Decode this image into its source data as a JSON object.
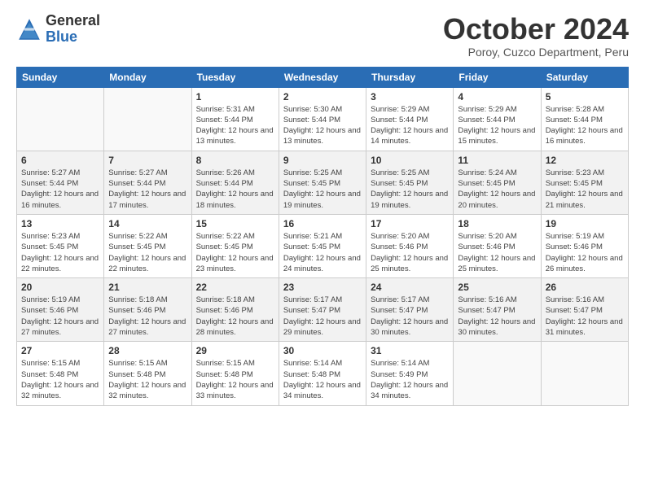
{
  "logo": {
    "general": "General",
    "blue": "Blue"
  },
  "title": "October 2024",
  "subtitle": "Poroy, Cuzco Department, Peru",
  "days_of_week": [
    "Sunday",
    "Monday",
    "Tuesday",
    "Wednesday",
    "Thursday",
    "Friday",
    "Saturday"
  ],
  "weeks": [
    [
      {
        "day": "",
        "sunrise": "",
        "sunset": "",
        "daylight": ""
      },
      {
        "day": "",
        "sunrise": "",
        "sunset": "",
        "daylight": ""
      },
      {
        "day": "1",
        "sunrise": "Sunrise: 5:31 AM",
        "sunset": "Sunset: 5:44 PM",
        "daylight": "Daylight: 12 hours and 13 minutes."
      },
      {
        "day": "2",
        "sunrise": "Sunrise: 5:30 AM",
        "sunset": "Sunset: 5:44 PM",
        "daylight": "Daylight: 12 hours and 13 minutes."
      },
      {
        "day": "3",
        "sunrise": "Sunrise: 5:29 AM",
        "sunset": "Sunset: 5:44 PM",
        "daylight": "Daylight: 12 hours and 14 minutes."
      },
      {
        "day": "4",
        "sunrise": "Sunrise: 5:29 AM",
        "sunset": "Sunset: 5:44 PM",
        "daylight": "Daylight: 12 hours and 15 minutes."
      },
      {
        "day": "5",
        "sunrise": "Sunrise: 5:28 AM",
        "sunset": "Sunset: 5:44 PM",
        "daylight": "Daylight: 12 hours and 16 minutes."
      }
    ],
    [
      {
        "day": "6",
        "sunrise": "Sunrise: 5:27 AM",
        "sunset": "Sunset: 5:44 PM",
        "daylight": "Daylight: 12 hours and 16 minutes."
      },
      {
        "day": "7",
        "sunrise": "Sunrise: 5:27 AM",
        "sunset": "Sunset: 5:44 PM",
        "daylight": "Daylight: 12 hours and 17 minutes."
      },
      {
        "day": "8",
        "sunrise": "Sunrise: 5:26 AM",
        "sunset": "Sunset: 5:44 PM",
        "daylight": "Daylight: 12 hours and 18 minutes."
      },
      {
        "day": "9",
        "sunrise": "Sunrise: 5:25 AM",
        "sunset": "Sunset: 5:45 PM",
        "daylight": "Daylight: 12 hours and 19 minutes."
      },
      {
        "day": "10",
        "sunrise": "Sunrise: 5:25 AM",
        "sunset": "Sunset: 5:45 PM",
        "daylight": "Daylight: 12 hours and 19 minutes."
      },
      {
        "day": "11",
        "sunrise": "Sunrise: 5:24 AM",
        "sunset": "Sunset: 5:45 PM",
        "daylight": "Daylight: 12 hours and 20 minutes."
      },
      {
        "day": "12",
        "sunrise": "Sunrise: 5:23 AM",
        "sunset": "Sunset: 5:45 PM",
        "daylight": "Daylight: 12 hours and 21 minutes."
      }
    ],
    [
      {
        "day": "13",
        "sunrise": "Sunrise: 5:23 AM",
        "sunset": "Sunset: 5:45 PM",
        "daylight": "Daylight: 12 hours and 22 minutes."
      },
      {
        "day": "14",
        "sunrise": "Sunrise: 5:22 AM",
        "sunset": "Sunset: 5:45 PM",
        "daylight": "Daylight: 12 hours and 22 minutes."
      },
      {
        "day": "15",
        "sunrise": "Sunrise: 5:22 AM",
        "sunset": "Sunset: 5:45 PM",
        "daylight": "Daylight: 12 hours and 23 minutes."
      },
      {
        "day": "16",
        "sunrise": "Sunrise: 5:21 AM",
        "sunset": "Sunset: 5:45 PM",
        "daylight": "Daylight: 12 hours and 24 minutes."
      },
      {
        "day": "17",
        "sunrise": "Sunrise: 5:20 AM",
        "sunset": "Sunset: 5:46 PM",
        "daylight": "Daylight: 12 hours and 25 minutes."
      },
      {
        "day": "18",
        "sunrise": "Sunrise: 5:20 AM",
        "sunset": "Sunset: 5:46 PM",
        "daylight": "Daylight: 12 hours and 25 minutes."
      },
      {
        "day": "19",
        "sunrise": "Sunrise: 5:19 AM",
        "sunset": "Sunset: 5:46 PM",
        "daylight": "Daylight: 12 hours and 26 minutes."
      }
    ],
    [
      {
        "day": "20",
        "sunrise": "Sunrise: 5:19 AM",
        "sunset": "Sunset: 5:46 PM",
        "daylight": "Daylight: 12 hours and 27 minutes."
      },
      {
        "day": "21",
        "sunrise": "Sunrise: 5:18 AM",
        "sunset": "Sunset: 5:46 PM",
        "daylight": "Daylight: 12 hours and 27 minutes."
      },
      {
        "day": "22",
        "sunrise": "Sunrise: 5:18 AM",
        "sunset": "Sunset: 5:46 PM",
        "daylight": "Daylight: 12 hours and 28 minutes."
      },
      {
        "day": "23",
        "sunrise": "Sunrise: 5:17 AM",
        "sunset": "Sunset: 5:47 PM",
        "daylight": "Daylight: 12 hours and 29 minutes."
      },
      {
        "day": "24",
        "sunrise": "Sunrise: 5:17 AM",
        "sunset": "Sunset: 5:47 PM",
        "daylight": "Daylight: 12 hours and 30 minutes."
      },
      {
        "day": "25",
        "sunrise": "Sunrise: 5:16 AM",
        "sunset": "Sunset: 5:47 PM",
        "daylight": "Daylight: 12 hours and 30 minutes."
      },
      {
        "day": "26",
        "sunrise": "Sunrise: 5:16 AM",
        "sunset": "Sunset: 5:47 PM",
        "daylight": "Daylight: 12 hours and 31 minutes."
      }
    ],
    [
      {
        "day": "27",
        "sunrise": "Sunrise: 5:15 AM",
        "sunset": "Sunset: 5:48 PM",
        "daylight": "Daylight: 12 hours and 32 minutes."
      },
      {
        "day": "28",
        "sunrise": "Sunrise: 5:15 AM",
        "sunset": "Sunset: 5:48 PM",
        "daylight": "Daylight: 12 hours and 32 minutes."
      },
      {
        "day": "29",
        "sunrise": "Sunrise: 5:15 AM",
        "sunset": "Sunset: 5:48 PM",
        "daylight": "Daylight: 12 hours and 33 minutes."
      },
      {
        "day": "30",
        "sunrise": "Sunrise: 5:14 AM",
        "sunset": "Sunset: 5:48 PM",
        "daylight": "Daylight: 12 hours and 34 minutes."
      },
      {
        "day": "31",
        "sunrise": "Sunrise: 5:14 AM",
        "sunset": "Sunset: 5:49 PM",
        "daylight": "Daylight: 12 hours and 34 minutes."
      },
      {
        "day": "",
        "sunrise": "",
        "sunset": "",
        "daylight": ""
      },
      {
        "day": "",
        "sunrise": "",
        "sunset": "",
        "daylight": ""
      }
    ]
  ]
}
